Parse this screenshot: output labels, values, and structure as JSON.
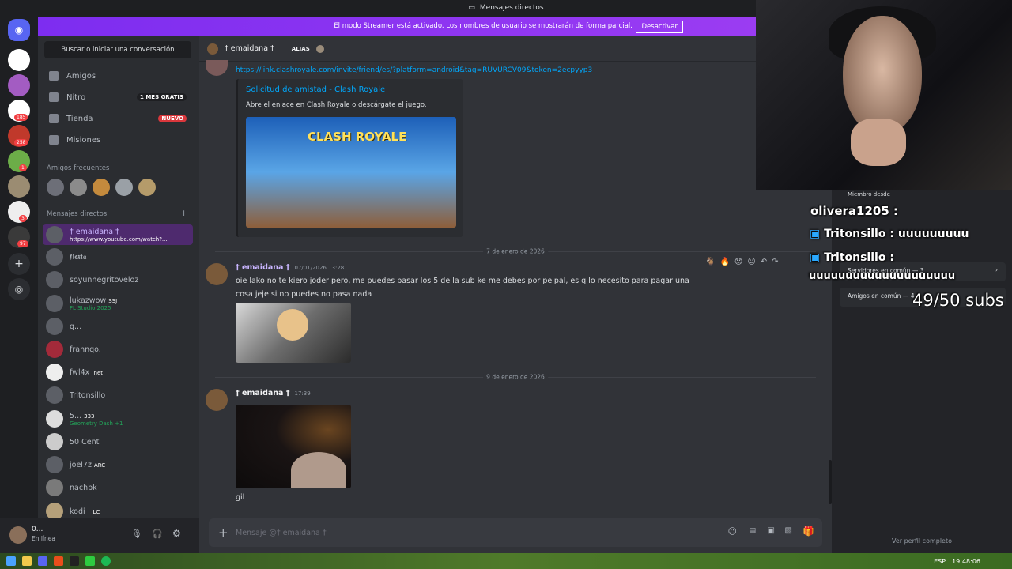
{
  "window": {
    "title": "Mensajes directos"
  },
  "banner": {
    "text": "El modo Streamer está activado. Los nombres de usuario se mostrarán de forma parcial.",
    "button": "Desactivar"
  },
  "servers": {
    "badges": [
      "185",
      "258",
      "1",
      "3",
      "97"
    ]
  },
  "sidebar": {
    "search": "Buscar o iniciar una conversación",
    "nav": [
      {
        "label": "Amigos"
      },
      {
        "label": "Nitro",
        "tag": "1 MES GRATIS"
      },
      {
        "label": "Tienda",
        "tag": "NUEVO"
      },
      {
        "label": "Misiones"
      }
    ],
    "frequent_title": "Amigos frecuentes",
    "dm_title": "Mensajes directos",
    "dms": [
      {
        "name": "† emaidana †",
        "sub": "https://www.youtube.com/watch?..."
      },
      {
        "name": "𝖋𝖑𝖊𝖝𝖙𝖆",
        "sub": ""
      },
      {
        "name": "soyunnegritoveloz",
        "sub": ""
      },
      {
        "name": "lukazwow",
        "tag": "SSJ",
        "sub": "FL Studio 2025"
      },
      {
        "name": "g...",
        "sub": ""
      },
      {
        "name": "frannqo.",
        "sub": ""
      },
      {
        "name": "fwl4x",
        "tag": ".net",
        "sub": ""
      },
      {
        "name": "Tritonsillo",
        "sub": ""
      },
      {
        "name": "5...",
        "tag": "333",
        "sub": "Geometry Dash +1"
      },
      {
        "name": "50 Cent",
        "sub": ""
      },
      {
        "name": "joel7z",
        "tag": "ARC",
        "sub": ""
      },
      {
        "name": "nachbk",
        "sub": ""
      },
      {
        "name": "kodi !",
        "tag": "LC",
        "sub": ""
      }
    ],
    "user": {
      "name": "0...",
      "status": "En línea"
    }
  },
  "chat": {
    "header_name": "† emaidana †",
    "header_alias": "ALIAS",
    "link": "https://link.clashroyale.com/invite/friend/es/?platform=android&tag=RUVURCV09&token=2ecpyyp3",
    "embed": {
      "title": "Solicitud de amistad - Clash Royale",
      "desc": "Abre el enlace en Clash Royale o descárgate el juego.",
      "image_text": "CLASH ROYALE"
    },
    "date1": "7 de enero de 2026",
    "msg1": {
      "name": "† emaidana †",
      "time": "07/01/2026 13:28",
      "text": "oie lako no te kiero joder pero, me puedes pasar los 5 de la sub ke me debes por peipal, es q lo necesito para pagar una cosa jeje si no puedes no pasa nada"
    },
    "date2": "9 de enero de 2026",
    "msg2": {
      "name": "† emaidana †",
      "time": "17:39",
      "text": "gil"
    },
    "composer_placeholder": "Mensaje @† emaidana †"
  },
  "profile": {
    "member_since": "Miembro desde",
    "servers_common": "Servidores en común — 3",
    "friends_common": "Amigos en común — 4",
    "full_profile": "Ver perfil completo"
  },
  "stream_overlay": {
    "chat": [
      {
        "user": "olivera1205",
        "text": ""
      },
      {
        "user": "Tritonsillo",
        "text": "uuuuuuuuu"
      },
      {
        "user": "Tritonsillo",
        "text": "uuuuuuuuuuuuuuuuuuuu"
      }
    ],
    "subs": "49/50 subs"
  },
  "taskbar": {
    "lang": "ESP",
    "time": "19:48:06"
  }
}
